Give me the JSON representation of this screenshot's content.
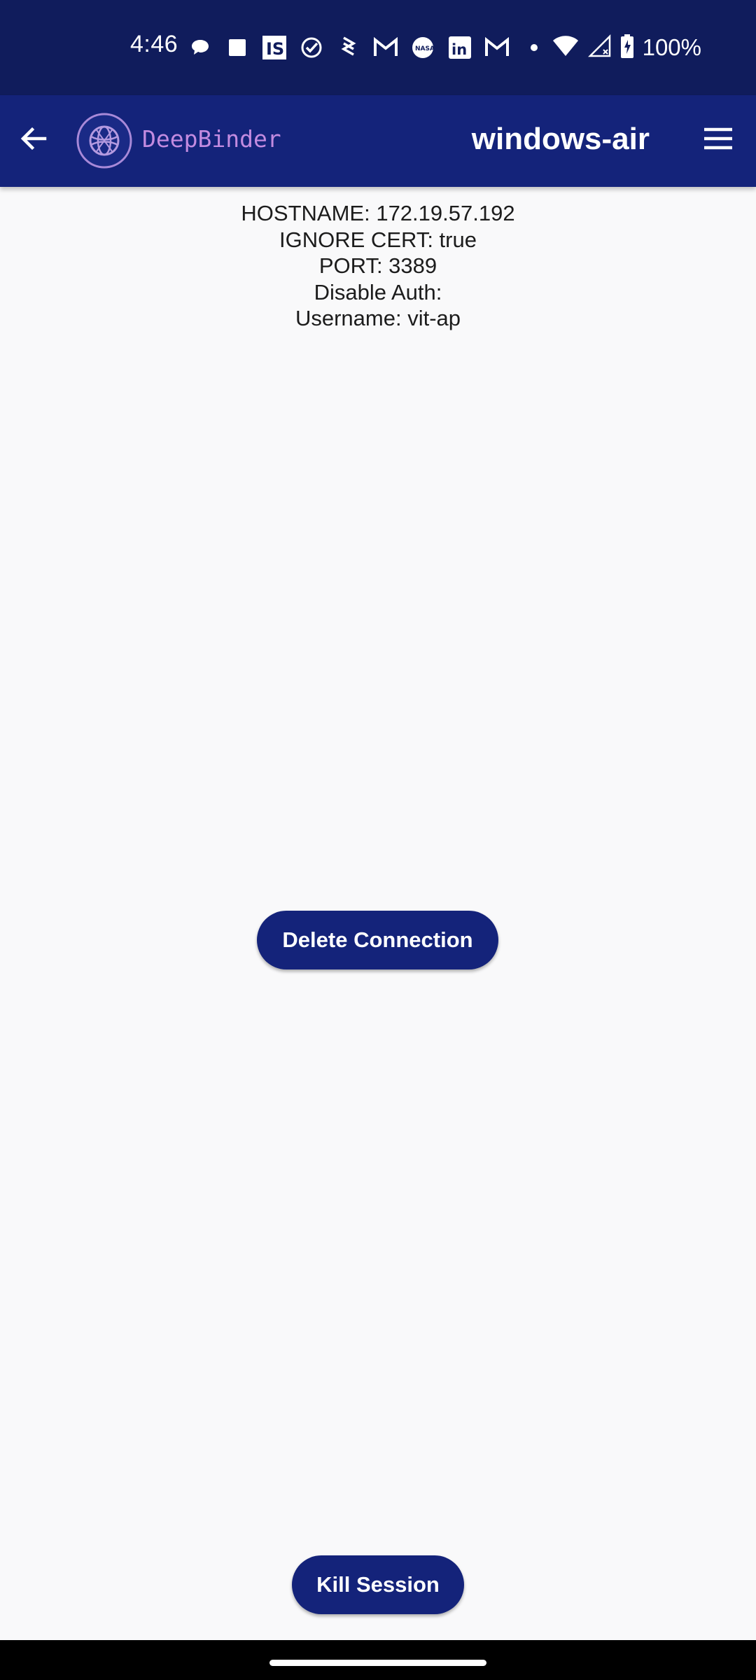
{
  "status_bar": {
    "time": "4:46",
    "battery_text": "100%",
    "notification_icons": [
      "chat-bubble-icon",
      "square-icon",
      "is-app-icon",
      "check-circle-icon",
      "bluetooth-like-icon",
      "gmail-icon",
      "nasa-icon",
      "linkedin-icon",
      "gmail-icon",
      "dot-icon"
    ],
    "system_icons": [
      "wifi-icon",
      "signal-icon",
      "battery-charging-icon"
    ]
  },
  "app_bar": {
    "brand_name": "DeepBinder",
    "title": "windows-air",
    "back_icon": "arrow-back-icon",
    "menu_icon": "hamburger-menu-icon",
    "logo_icon": "globe-logo-icon"
  },
  "connection": {
    "hostname": "HOSTNAME: 172.19.57.192",
    "ignore_cert": "IGNORE CERT: true",
    "port": "PORT: 3389",
    "disable_auth": "Disable Auth:",
    "username": "Username: vit-ap"
  },
  "actions": {
    "delete_label": "Delete Connection",
    "kill_label": "Kill Session"
  },
  "colors": {
    "status_bar_bg": "#101c5c",
    "app_bar_bg": "#14237a",
    "brand_text": "#c38be0",
    "button_bg": "#14237a",
    "page_bg": "#f9f9fa"
  }
}
